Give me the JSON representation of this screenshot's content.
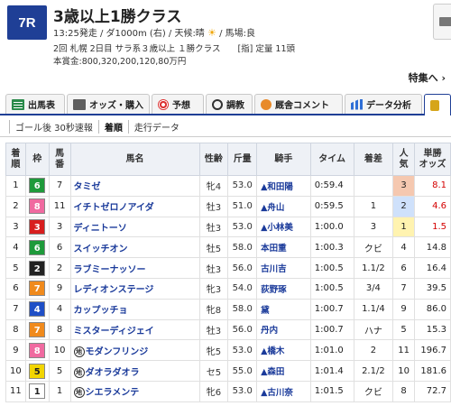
{
  "race": {
    "number": "7R",
    "title": "3歳以上1勝クラス",
    "meta": "13:25発走 / ダ1000m (右) / 天候:晴",
    "weather_icon": "sun-icon",
    "track": " / 馬場:良",
    "line2": "2回 札幌 2日目 サラ系３歳以上 １勝クラス　　[指] 定量 11頭",
    "line3": "本賞金:800,320,200,120,80万円",
    "special": "特集へ ›"
  },
  "tabs": [
    {
      "label": "出馬表",
      "icon": "grid-icon"
    },
    {
      "label": "オッズ・購入",
      "icon": "odds-icon"
    },
    {
      "label": "予想",
      "icon": "target-icon"
    },
    {
      "label": "調教",
      "icon": "stopwatch-icon"
    },
    {
      "label": "厩舎コメント",
      "icon": "comment-icon"
    },
    {
      "label": "データ分析",
      "icon": "data-icon"
    },
    {
      "label": "",
      "icon": "coin-icon"
    }
  ],
  "subtabs": [
    "ゴール後 30秒速報",
    "着順",
    "走行データ"
  ],
  "table": {
    "headers": [
      "着\n順",
      "枠",
      "馬\n番",
      "馬名",
      "性齢",
      "斤量",
      "騎手",
      "タイム",
      "着差",
      "人\n気",
      "単勝\nオッズ"
    ],
    "rows": [
      {
        "rank": "1",
        "waku": "6",
        "num": "7",
        "name": "タミゼ",
        "mark": "",
        "sex": "牝4",
        "weight": "53.0",
        "jockey": "▲和田陽",
        "time": "0:59.4",
        "diff": "",
        "pop": "3",
        "odds": "8.1"
      },
      {
        "rank": "2",
        "waku": "8",
        "num": "11",
        "name": "イチトゼロノアイダ",
        "mark": "",
        "sex": "牡3",
        "weight": "51.0",
        "jockey": "▲舟山",
        "time": "0:59.5",
        "diff": "1",
        "pop": "2",
        "odds": "4.6"
      },
      {
        "rank": "3",
        "waku": "3",
        "num": "3",
        "name": "ディニトーソ",
        "mark": "",
        "sex": "牡3",
        "weight": "53.0",
        "jockey": "▲小林美",
        "time": "1:00.0",
        "diff": "3",
        "pop": "1",
        "odds": "1.5"
      },
      {
        "rank": "4",
        "waku": "6",
        "num": "6",
        "name": "スイッチオン",
        "mark": "",
        "sex": "牡5",
        "weight": "58.0",
        "jockey": "本田重",
        "time": "1:00.3",
        "diff": "クビ",
        "pop": "4",
        "odds": "14.8"
      },
      {
        "rank": "5",
        "waku": "2",
        "num": "2",
        "name": "ラブミーナッソー",
        "mark": "",
        "sex": "牡3",
        "weight": "56.0",
        "jockey": "古川吉",
        "time": "1:00.5",
        "diff": "1.1/2",
        "pop": "6",
        "odds": "16.4"
      },
      {
        "rank": "6",
        "waku": "7",
        "num": "9",
        "name": "レディオンステージ",
        "mark": "",
        "sex": "牝3",
        "weight": "54.0",
        "jockey": "荻野琢",
        "time": "1:00.5",
        "diff": "3/4",
        "pop": "7",
        "odds": "39.5"
      },
      {
        "rank": "7",
        "waku": "4",
        "num": "4",
        "name": "カップッチョ",
        "mark": "",
        "sex": "牝8",
        "weight": "58.0",
        "jockey": "黛",
        "time": "1:00.7",
        "diff": "1.1/4",
        "pop": "9",
        "odds": "86.0"
      },
      {
        "rank": "8",
        "waku": "7",
        "num": "8",
        "name": "ミスターディジェイ",
        "mark": "",
        "sex": "牡3",
        "weight": "56.0",
        "jockey": "丹内",
        "time": "1:00.7",
        "diff": "ハナ",
        "pop": "5",
        "odds": "15.3"
      },
      {
        "rank": "9",
        "waku": "8",
        "num": "10",
        "name": "モダンフリンジ",
        "mark": "地",
        "sex": "牝5",
        "weight": "53.0",
        "jockey": "▲橋木",
        "time": "1:01.0",
        "diff": "2",
        "pop": "11",
        "odds": "196.7"
      },
      {
        "rank": "10",
        "waku": "5",
        "num": "5",
        "name": "ダオラダオラ",
        "mark": "地",
        "sex": "セ5",
        "weight": "55.0",
        "jockey": "▲森田",
        "time": "1:01.4",
        "diff": "2.1/2",
        "pop": "10",
        "odds": "181.6"
      },
      {
        "rank": "11",
        "waku": "1",
        "num": "1",
        "name": "シエラメンテ",
        "mark": "地",
        "sex": "牝6",
        "weight": "53.0",
        "jockey": "▲古川奈",
        "time": "1:01.5",
        "diff": "クビ",
        "pop": "8",
        "odds": "72.7"
      }
    ]
  },
  "waku_colors": {
    "1": {
      "bg": "#ffffff",
      "fg": "#222222"
    },
    "2": {
      "bg": "#222222",
      "fg": "#ffffff"
    },
    "3": {
      "bg": "#d81e1e",
      "fg": "#ffffff"
    },
    "4": {
      "bg": "#1f4fc6",
      "fg": "#ffffff"
    },
    "5": {
      "bg": "#f2d500",
      "fg": "#222222"
    },
    "6": {
      "bg": "#1e9a3a",
      "fg": "#ffffff"
    },
    "7": {
      "bg": "#f08a1c",
      "fg": "#ffffff"
    },
    "8": {
      "bg": "#f06aa0",
      "fg": "#ffffff"
    }
  }
}
